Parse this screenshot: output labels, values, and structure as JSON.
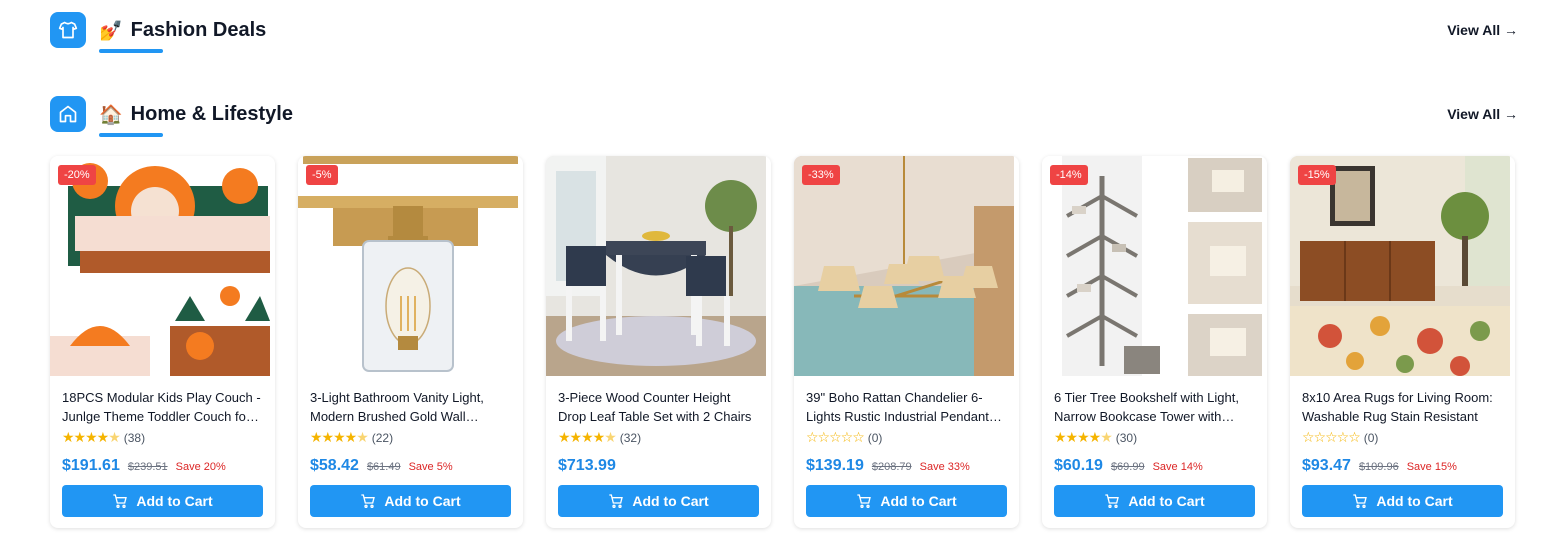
{
  "sections": [
    {
      "emoji": "💅",
      "title": "Fashion Deals",
      "view_all": "View All →",
      "icon": "shirt-icon"
    },
    {
      "emoji": "🏠",
      "title": "Home & Lifestyle",
      "view_all": "View All →",
      "icon": "home-icon"
    }
  ],
  "products": [
    {
      "name": "18PCS Modular Kids Play Couch - Junlge Theme Toddler Couch for Playroom",
      "discount": "-20%",
      "rating": 4.5,
      "reviews": "(38)",
      "price": "$191.61",
      "original_price": "$239.51",
      "save": "Save 20%",
      "button": "Add to Cart"
    },
    {
      "name": "3-Light Bathroom Vanity Light, Modern Brushed Gold Wall Sconce",
      "discount": "-5%",
      "rating": 4.5,
      "reviews": "(22)",
      "price": "$58.42",
      "original_price": "$61.49",
      "save": "Save 5%",
      "button": "Add to Cart"
    },
    {
      "name": "3-Piece Wood Counter Height Drop Leaf Table Set with 2 Chairs",
      "discount": "",
      "rating": 4.5,
      "reviews": "(32)",
      "price": "$713.99",
      "original_price": "",
      "save": "",
      "button": "Add to Cart"
    },
    {
      "name": "39\" Boho Rattan Chandelier 6-Lights Rustic Industrial Pendant Light",
      "discount": "-33%",
      "rating": 0,
      "reviews": "(0)",
      "price": "$139.19",
      "original_price": "$208.79",
      "save": "Save 33%",
      "button": "Add to Cart"
    },
    {
      "name": "6 Tier Tree Bookshelf with Light, Narrow Bookcase Tower with Drawer",
      "discount": "-14%",
      "rating": 4.5,
      "reviews": "(30)",
      "price": "$60.19",
      "original_price": "$69.99",
      "save": "Save 14%",
      "button": "Add to Cart"
    },
    {
      "name": "8x10 Area Rugs for Living Room: Washable Rug Stain Resistant",
      "discount": "-15%",
      "rating": 0,
      "reviews": "(0)",
      "price": "$93.47",
      "original_price": "$109.96",
      "save": "Save 15%",
      "button": "Add to Cart"
    }
  ],
  "colors": {
    "accent": "#2196f3",
    "price": "#1e88e5",
    "badge": "#ef4444",
    "save": "#dc2626",
    "star": "#f5b400"
  }
}
